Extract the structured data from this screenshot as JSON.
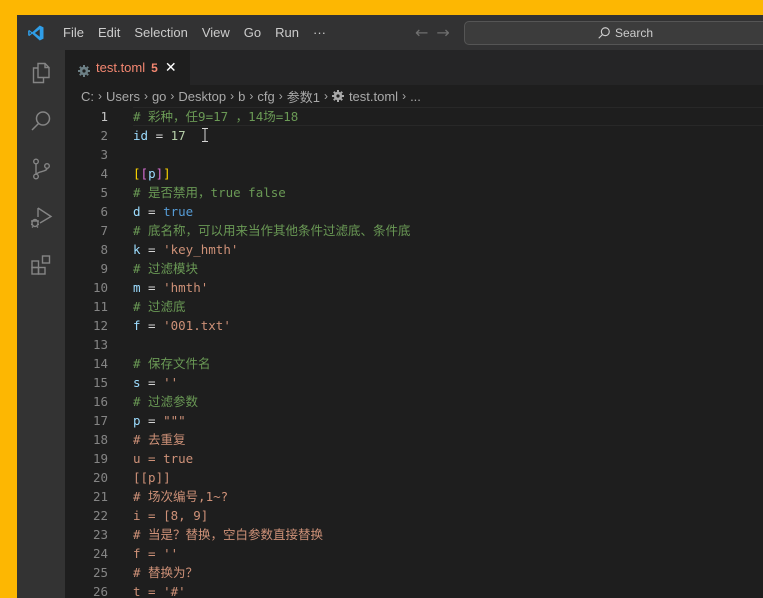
{
  "titlebar": {
    "menu": [
      "File",
      "Edit",
      "Selection",
      "View",
      "Go",
      "Run",
      "···"
    ],
    "search_placeholder": "Search",
    "back_icon": "←",
    "forward_icon": "→"
  },
  "activitybar": {
    "items": [
      "explorer",
      "search",
      "source-control",
      "run-and-debug",
      "extensions"
    ]
  },
  "tab": {
    "name": "test.toml",
    "problems": "5",
    "close": "✕"
  },
  "breadcrumb": [
    "C:",
    "Users",
    "go",
    "Desktop",
    "b",
    "cfg",
    "参数1",
    "test.toml",
    "..."
  ],
  "breadcrumb_sep": "›",
  "colors": {
    "accent_background": "#fdb702",
    "error_text": "#f48771",
    "comment": "#6a9955",
    "string": "#ce9178",
    "keyword": "#569cd6"
  },
  "editor": {
    "active_line": 1,
    "lines": [
      {
        "n": "1",
        "tokens": [
          [
            "c-comment",
            "# 彩种，任9=17 ，14场=18"
          ]
        ]
      },
      {
        "n": "2",
        "tokens": [
          [
            "c-key",
            "id"
          ],
          [
            "c-op",
            " = "
          ],
          [
            "c-num",
            "17"
          ]
        ]
      },
      {
        "n": "3",
        "tokens": []
      },
      {
        "n": "4",
        "tokens": [
          [
            "c-b1",
            "["
          ],
          [
            "c-b2",
            "["
          ],
          [
            "c-key",
            "p"
          ],
          [
            "c-b2",
            "]"
          ],
          [
            "c-b1",
            "]"
          ]
        ]
      },
      {
        "n": "5",
        "tokens": [
          [
            "c-comment",
            "# 是否禁用，true false"
          ]
        ]
      },
      {
        "n": "6",
        "tokens": [
          [
            "c-key",
            "d"
          ],
          [
            "c-op",
            " = "
          ],
          [
            "c-bool",
            "true"
          ]
        ]
      },
      {
        "n": "7",
        "tokens": [
          [
            "c-comment",
            "# 底名称，可以用来当作其他条件过滤底、条件底"
          ]
        ]
      },
      {
        "n": "8",
        "tokens": [
          [
            "c-key",
            "k"
          ],
          [
            "c-op",
            " = "
          ],
          [
            "c-str",
            "'key_hmth'"
          ]
        ]
      },
      {
        "n": "9",
        "tokens": [
          [
            "c-comment",
            "# 过滤模块"
          ]
        ]
      },
      {
        "n": "10",
        "tokens": [
          [
            "c-key",
            "m"
          ],
          [
            "c-op",
            " = "
          ],
          [
            "c-str",
            "'hmth'"
          ]
        ]
      },
      {
        "n": "11",
        "tokens": [
          [
            "c-comment",
            "# 过滤底"
          ]
        ]
      },
      {
        "n": "12",
        "tokens": [
          [
            "c-key",
            "f"
          ],
          [
            "c-op",
            " = "
          ],
          [
            "c-str",
            "'001.txt'"
          ]
        ]
      },
      {
        "n": "13",
        "tokens": []
      },
      {
        "n": "14",
        "tokens": [
          [
            "c-comment",
            "# 保存文件名"
          ]
        ]
      },
      {
        "n": "15",
        "tokens": [
          [
            "c-key",
            "s"
          ],
          [
            "c-op",
            " = "
          ],
          [
            "c-str",
            "''"
          ]
        ]
      },
      {
        "n": "16",
        "tokens": [
          [
            "c-comment",
            "# 过滤参数"
          ]
        ]
      },
      {
        "n": "17",
        "tokens": [
          [
            "c-key",
            "p"
          ],
          [
            "c-op",
            " = "
          ],
          [
            "c-str",
            "\"\"\""
          ]
        ]
      },
      {
        "n": "18",
        "tokens": [
          [
            "c-err",
            "# 去重复"
          ]
        ]
      },
      {
        "n": "19",
        "tokens": [
          [
            "c-err",
            "u = true"
          ]
        ]
      },
      {
        "n": "20",
        "tokens": [
          [
            "c-err",
            "[[p]]"
          ]
        ]
      },
      {
        "n": "21",
        "tokens": [
          [
            "c-err",
            "# 场次编号,1~?"
          ]
        ]
      },
      {
        "n": "22",
        "tokens": [
          [
            "c-err",
            "i = [8, 9]"
          ]
        ]
      },
      {
        "n": "23",
        "tokens": [
          [
            "c-err",
            "# 当是？替换，空白参数直接替换"
          ]
        ]
      },
      {
        "n": "24",
        "tokens": [
          [
            "c-err",
            "f = ''"
          ]
        ]
      },
      {
        "n": "25",
        "tokens": [
          [
            "c-err",
            "# 替换为？"
          ]
        ]
      },
      {
        "n": "26",
        "tokens": [
          [
            "c-err",
            "t = '#'"
          ]
        ]
      }
    ]
  }
}
